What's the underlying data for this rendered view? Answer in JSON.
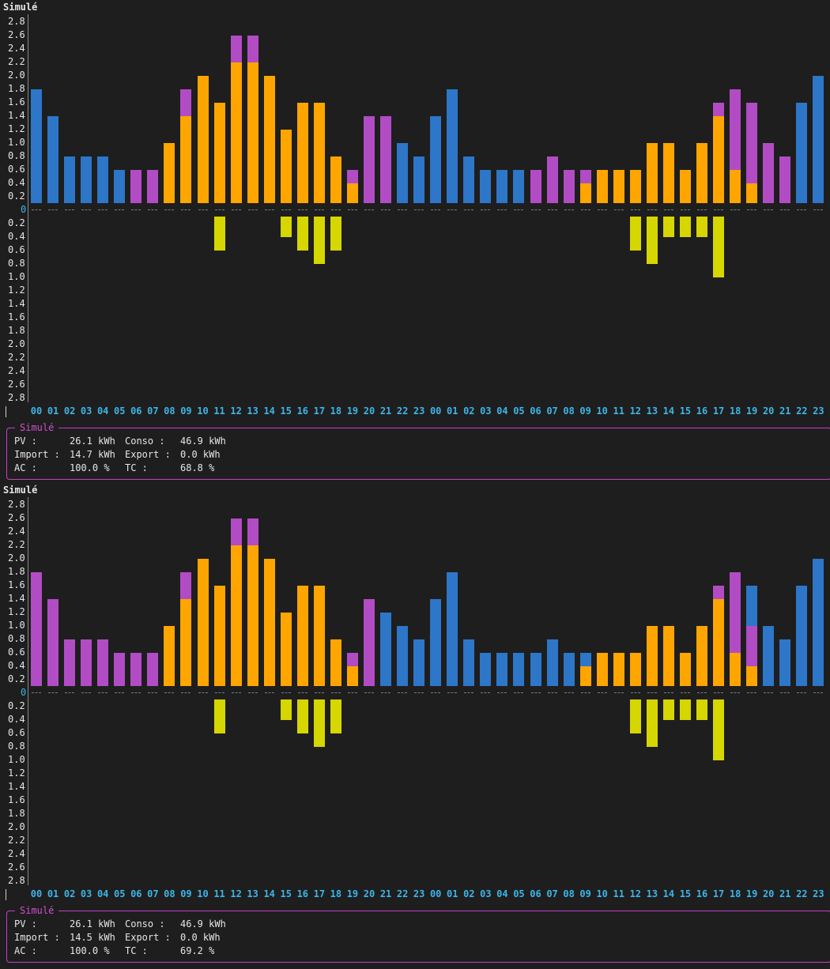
{
  "panels": [
    {
      "title": "Simulé",
      "summary": {
        "legend": "Simulé",
        "rows": [
          {
            "l1": "PV :",
            "v1": "26.1 kWh",
            "l2": "Conso :",
            "v2": "46.9 kWh"
          },
          {
            "l1": "Import :",
            "v1": "14.7 kWh",
            "l2": "Export :",
            "v2": "0.0 kWh"
          },
          {
            "l1": "AC :",
            "v1": "100.0 %",
            "l2": "TC :",
            "v2": "68.8 %"
          }
        ]
      }
    },
    {
      "title": "Simulé",
      "summary": {
        "legend": "Simulé",
        "rows": [
          {
            "l1": "PV :",
            "v1": "26.1 kWh",
            "l2": "Conso :",
            "v2": "46.9 kWh"
          },
          {
            "l1": "Import :",
            "v1": "14.5 kWh",
            "l2": "Export :",
            "v2": "0.0 kWh"
          },
          {
            "l1": "AC :",
            "v1": "100.0 %",
            "l2": "TC :",
            "v2": "69.2 %"
          }
        ]
      }
    }
  ],
  "colors": {
    "blue": "#2d76c8",
    "magenta": "#b24cc4",
    "orange": "#ffa500",
    "yellow": "#d6d600"
  },
  "chart_data": [
    {
      "type": "bar",
      "title": "Simulé",
      "y_ticks": [
        "2.8",
        "2.6",
        "2.4",
        "2.2",
        "2.0",
        "1.8",
        "1.6",
        "1.4",
        "1.2",
        "1.0",
        "0.8",
        "0.6",
        "0.4",
        "0.2",
        "0",
        "0.2",
        "0.4",
        "0.6",
        "0.8",
        "1.0",
        "1.2",
        "1.4",
        "1.6",
        "1.8",
        "2.0",
        "2.2",
        "2.4",
        "2.6",
        "2.8"
      ],
      "ylim": [
        -2.8,
        2.8
      ],
      "categories": [
        "00",
        "01",
        "02",
        "03",
        "04",
        "05",
        "06",
        "07",
        "08",
        "09",
        "10",
        "11",
        "12",
        "13",
        "14",
        "15",
        "16",
        "17",
        "18",
        "19",
        "20",
        "21",
        "22",
        "23",
        "00",
        "01",
        "02",
        "03",
        "04",
        "05",
        "06",
        "07",
        "08",
        "09",
        "10",
        "11",
        "12",
        "13",
        "14",
        "15",
        "16",
        "17",
        "18",
        "19",
        "20",
        "21",
        "22",
        "23"
      ],
      "stacks": [
        [
          {
            "c": "blue",
            "v": 1.7
          }
        ],
        [
          {
            "c": "blue",
            "v": 1.3
          }
        ],
        [
          {
            "c": "blue",
            "v": 0.7
          }
        ],
        [
          {
            "c": "blue",
            "v": 0.7
          }
        ],
        [
          {
            "c": "blue",
            "v": 0.7
          }
        ],
        [
          {
            "c": "blue",
            "v": 0.5
          }
        ],
        [
          {
            "c": "magenta",
            "v": 0.5
          }
        ],
        [
          {
            "c": "magenta",
            "v": 0.5
          }
        ],
        [
          {
            "c": "orange",
            "v": 0.9
          }
        ],
        [
          {
            "c": "orange",
            "v": 1.3
          },
          {
            "c": "magenta",
            "v": 0.4
          }
        ],
        [
          {
            "c": "orange",
            "v": 1.9
          }
        ],
        [
          {
            "c": "orange",
            "v": 1.5
          }
        ],
        [
          {
            "c": "orange",
            "v": 2.1
          },
          {
            "c": "magenta",
            "v": 0.4
          }
        ],
        [
          {
            "c": "orange",
            "v": 2.1
          },
          {
            "c": "magenta",
            "v": 0.4
          }
        ],
        [
          {
            "c": "orange",
            "v": 1.9
          }
        ],
        [
          {
            "c": "orange",
            "v": 1.1
          }
        ],
        [
          {
            "c": "orange",
            "v": 1.5
          }
        ],
        [
          {
            "c": "orange",
            "v": 1.5
          }
        ],
        [
          {
            "c": "orange",
            "v": 0.7
          }
        ],
        [
          {
            "c": "orange",
            "v": 0.3
          },
          {
            "c": "magenta",
            "v": 0.2
          }
        ],
        [
          {
            "c": "magenta",
            "v": 1.3
          }
        ],
        [
          {
            "c": "magenta",
            "v": 1.3
          }
        ],
        [
          {
            "c": "blue",
            "v": 0.9
          }
        ],
        [
          {
            "c": "blue",
            "v": 0.7
          }
        ],
        [
          {
            "c": "blue",
            "v": 1.3
          }
        ],
        [
          {
            "c": "blue",
            "v": 1.7
          }
        ],
        [
          {
            "c": "blue",
            "v": 0.7
          }
        ],
        [
          {
            "c": "blue",
            "v": 0.5
          }
        ],
        [
          {
            "c": "blue",
            "v": 0.5
          }
        ],
        [
          {
            "c": "blue",
            "v": 0.5
          }
        ],
        [
          {
            "c": "magenta",
            "v": 0.5
          }
        ],
        [
          {
            "c": "magenta",
            "v": 0.7
          }
        ],
        [
          {
            "c": "magenta",
            "v": 0.5
          }
        ],
        [
          {
            "c": "orange",
            "v": 0.3
          },
          {
            "c": "magenta",
            "v": 0.2
          }
        ],
        [
          {
            "c": "orange",
            "v": 0.5
          }
        ],
        [
          {
            "c": "orange",
            "v": 0.5
          }
        ],
        [
          {
            "c": "orange",
            "v": 0.5
          }
        ],
        [
          {
            "c": "orange",
            "v": 0.9
          }
        ],
        [
          {
            "c": "orange",
            "v": 0.9
          }
        ],
        [
          {
            "c": "orange",
            "v": 0.5
          }
        ],
        [
          {
            "c": "orange",
            "v": 0.9
          }
        ],
        [
          {
            "c": "orange",
            "v": 1.3
          },
          {
            "c": "magenta",
            "v": 0.2
          }
        ],
        [
          {
            "c": "orange",
            "v": 0.5
          },
          {
            "c": "magenta",
            "v": 1.2
          }
        ],
        [
          {
            "c": "orange",
            "v": 0.3
          },
          {
            "c": "magenta",
            "v": 1.2
          }
        ],
        [
          {
            "c": "magenta",
            "v": 0.9
          }
        ],
        [
          {
            "c": "magenta",
            "v": 0.7
          }
        ],
        [
          {
            "c": "blue",
            "v": 1.5
          }
        ],
        [
          {
            "c": "blue",
            "v": 1.9
          }
        ]
      ],
      "negative": {
        "color": "yellow",
        "values": [
          0,
          0,
          0,
          0,
          0,
          0,
          0,
          0,
          0,
          0,
          0,
          0.5,
          0,
          0,
          0,
          0.3,
          0.5,
          0.7,
          0.5,
          0,
          0,
          0,
          0,
          0,
          0,
          0,
          0,
          0,
          0,
          0,
          0,
          0,
          0,
          0,
          0,
          0,
          0.5,
          0.7,
          0.3,
          0.3,
          0.3,
          0.9,
          0,
          0,
          0,
          0,
          0,
          0
        ]
      }
    },
    {
      "type": "bar",
      "title": "Simulé",
      "y_ticks": [
        "2.8",
        "2.6",
        "2.4",
        "2.2",
        "2.0",
        "1.8",
        "1.6",
        "1.4",
        "1.2",
        "1.0",
        "0.8",
        "0.6",
        "0.4",
        "0.2",
        "0",
        "0.2",
        "0.4",
        "0.6",
        "0.8",
        "1.0",
        "1.2",
        "1.4",
        "1.6",
        "1.8",
        "2.0",
        "2.2",
        "2.4",
        "2.6",
        "2.8"
      ],
      "ylim": [
        -2.8,
        2.8
      ],
      "categories": [
        "00",
        "01",
        "02",
        "03",
        "04",
        "05",
        "06",
        "07",
        "08",
        "09",
        "10",
        "11",
        "12",
        "13",
        "14",
        "15",
        "16",
        "17",
        "18",
        "19",
        "20",
        "21",
        "22",
        "23",
        "00",
        "01",
        "02",
        "03",
        "04",
        "05",
        "06",
        "07",
        "08",
        "09",
        "10",
        "11",
        "12",
        "13",
        "14",
        "15",
        "16",
        "17",
        "18",
        "19",
        "20",
        "21",
        "22",
        "23"
      ],
      "stacks": [
        [
          {
            "c": "magenta",
            "v": 1.7
          }
        ],
        [
          {
            "c": "magenta",
            "v": 1.3
          }
        ],
        [
          {
            "c": "magenta",
            "v": 0.7
          }
        ],
        [
          {
            "c": "magenta",
            "v": 0.7
          }
        ],
        [
          {
            "c": "magenta",
            "v": 0.7
          }
        ],
        [
          {
            "c": "magenta",
            "v": 0.5
          }
        ],
        [
          {
            "c": "magenta",
            "v": 0.5
          }
        ],
        [
          {
            "c": "magenta",
            "v": 0.5
          }
        ],
        [
          {
            "c": "orange",
            "v": 0.9
          }
        ],
        [
          {
            "c": "orange",
            "v": 1.3
          },
          {
            "c": "magenta",
            "v": 0.4
          }
        ],
        [
          {
            "c": "orange",
            "v": 1.9
          }
        ],
        [
          {
            "c": "orange",
            "v": 1.5
          }
        ],
        [
          {
            "c": "orange",
            "v": 2.1
          },
          {
            "c": "magenta",
            "v": 0.4
          }
        ],
        [
          {
            "c": "orange",
            "v": 2.1
          },
          {
            "c": "magenta",
            "v": 0.4
          }
        ],
        [
          {
            "c": "orange",
            "v": 1.9
          }
        ],
        [
          {
            "c": "orange",
            "v": 1.1
          }
        ],
        [
          {
            "c": "orange",
            "v": 1.5
          }
        ],
        [
          {
            "c": "orange",
            "v": 1.5
          }
        ],
        [
          {
            "c": "orange",
            "v": 0.7
          }
        ],
        [
          {
            "c": "orange",
            "v": 0.3
          },
          {
            "c": "magenta",
            "v": 0.2
          }
        ],
        [
          {
            "c": "magenta",
            "v": 1.3
          }
        ],
        [
          {
            "c": "blue",
            "v": 1.1
          }
        ],
        [
          {
            "c": "blue",
            "v": 0.9
          }
        ],
        [
          {
            "c": "blue",
            "v": 0.7
          }
        ],
        [
          {
            "c": "blue",
            "v": 1.3
          }
        ],
        [
          {
            "c": "blue",
            "v": 1.7
          }
        ],
        [
          {
            "c": "blue",
            "v": 0.7
          }
        ],
        [
          {
            "c": "blue",
            "v": 0.5
          }
        ],
        [
          {
            "c": "blue",
            "v": 0.5
          }
        ],
        [
          {
            "c": "blue",
            "v": 0.5
          }
        ],
        [
          {
            "c": "blue",
            "v": 0.5
          }
        ],
        [
          {
            "c": "blue",
            "v": 0.7
          }
        ],
        [
          {
            "c": "blue",
            "v": 0.5
          }
        ],
        [
          {
            "c": "orange",
            "v": 0.3
          },
          {
            "c": "blue",
            "v": 0.2
          }
        ],
        [
          {
            "c": "orange",
            "v": 0.5
          }
        ],
        [
          {
            "c": "orange",
            "v": 0.5
          }
        ],
        [
          {
            "c": "orange",
            "v": 0.5
          }
        ],
        [
          {
            "c": "orange",
            "v": 0.9
          }
        ],
        [
          {
            "c": "orange",
            "v": 0.9
          }
        ],
        [
          {
            "c": "orange",
            "v": 0.5
          }
        ],
        [
          {
            "c": "orange",
            "v": 0.9
          }
        ],
        [
          {
            "c": "orange",
            "v": 1.3
          },
          {
            "c": "magenta",
            "v": 0.2
          }
        ],
        [
          {
            "c": "orange",
            "v": 0.5
          },
          {
            "c": "magenta",
            "v": 1.2
          }
        ],
        [
          {
            "c": "orange",
            "v": 0.3
          },
          {
            "c": "magenta",
            "v": 0.6
          },
          {
            "c": "blue",
            "v": 0.6
          }
        ],
        [
          {
            "c": "blue",
            "v": 0.9
          }
        ],
        [
          {
            "c": "blue",
            "v": 0.7
          }
        ],
        [
          {
            "c": "blue",
            "v": 1.5
          }
        ],
        [
          {
            "c": "blue",
            "v": 1.9
          }
        ]
      ],
      "negative": {
        "color": "yellow",
        "values": [
          0,
          0,
          0,
          0,
          0,
          0,
          0,
          0,
          0,
          0,
          0,
          0.5,
          0,
          0,
          0,
          0.3,
          0.5,
          0.7,
          0.5,
          0,
          0,
          0,
          0,
          0,
          0,
          0,
          0,
          0,
          0,
          0,
          0,
          0,
          0,
          0,
          0,
          0,
          0.5,
          0.7,
          0.3,
          0.3,
          0.3,
          0.9,
          0,
          0,
          0,
          0,
          0,
          0
        ]
      }
    }
  ]
}
